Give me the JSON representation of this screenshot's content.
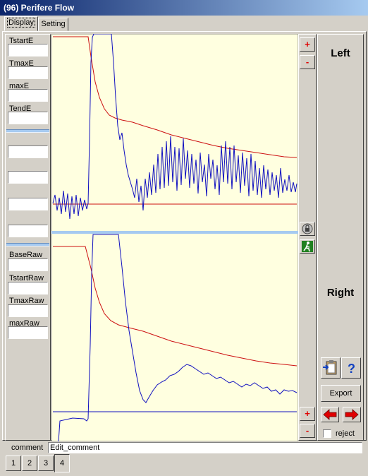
{
  "window": {
    "title": "(96) Perifere Flow"
  },
  "tabs": [
    {
      "label": "Display",
      "active": true
    },
    {
      "label": "Setting",
      "active": false
    }
  ],
  "left_panel": {
    "fields_top": [
      {
        "label": "TstartE",
        "value": ""
      },
      {
        "label": "TmaxE",
        "value": ""
      },
      {
        "label": "maxE",
        "value": ""
      },
      {
        "label": "TendE",
        "value": ""
      }
    ],
    "fields_mid": [
      {
        "value": ""
      },
      {
        "value": ""
      },
      {
        "value": ""
      },
      {
        "value": ""
      }
    ],
    "fields_bottom": [
      {
        "label": "BaseRaw",
        "value": ""
      },
      {
        "label": "TstartRaw",
        "value": ""
      },
      {
        "label": "TmaxRaw",
        "value": ""
      },
      {
        "label": "maxRaw",
        "value": ""
      }
    ]
  },
  "scale": {
    "plus": "+",
    "minus": "-"
  },
  "right_panel": {
    "left_label": "Left",
    "right_label": "Right",
    "export_label": "Export",
    "reject_label": "reject",
    "reject_checked": false
  },
  "comment": {
    "label": "comment",
    "value": "Edit_comment"
  },
  "pages": [
    "1",
    "2",
    "3",
    "4"
  ],
  "active_page": "4",
  "colors": {
    "plot_bg": "#ffffe0",
    "signal": "#1010c0",
    "trend": "#cc1010",
    "divider": "#a6caf0"
  },
  "icons": {
    "lock": "lock-icon",
    "run": "running-man-icon",
    "clipboard": "clipboard-icon",
    "help": "help-icon",
    "arrow_left": "red-arrow-left-icon",
    "arrow_right": "red-arrow-right-icon"
  }
}
